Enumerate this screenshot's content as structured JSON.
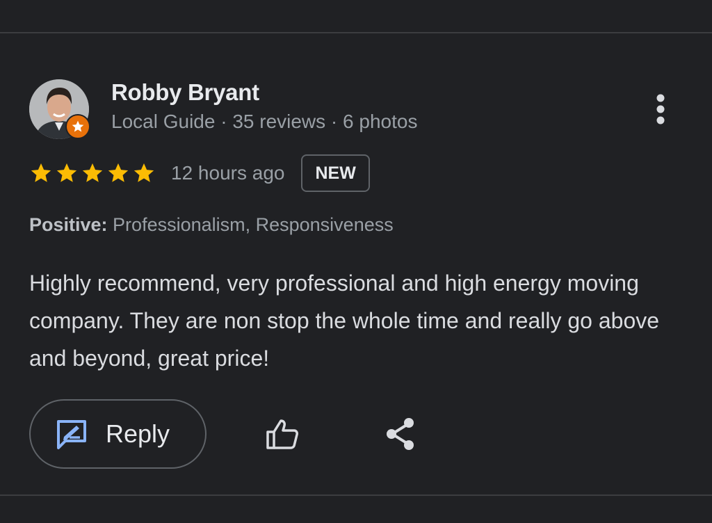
{
  "reviewer": {
    "name": "Robby Bryant",
    "meta": "Local Guide · 35 reviews · 6 photos",
    "local_guide_badge": "local-guide-star-icon"
  },
  "review": {
    "rating": 5,
    "rating_max": 5,
    "time": "12 hours ago",
    "new_badge": "NEW",
    "positive_label": "Positive:",
    "positive_values": " Professionalism, Responsiveness",
    "text": "Highly recommend, very professional and high energy moving company. They are non stop the whole time and really go above and beyond, great price!"
  },
  "actions": {
    "reply_label": "Reply",
    "reply_icon": "reply-icon",
    "like_icon": "thumbs-up-icon",
    "share_icon": "share-icon",
    "more_icon": "more-vert-icon"
  },
  "colors": {
    "background": "#202124",
    "star": "#fbbc04",
    "badge": "#e8710a",
    "reply_icon": "#8ab4f8"
  }
}
